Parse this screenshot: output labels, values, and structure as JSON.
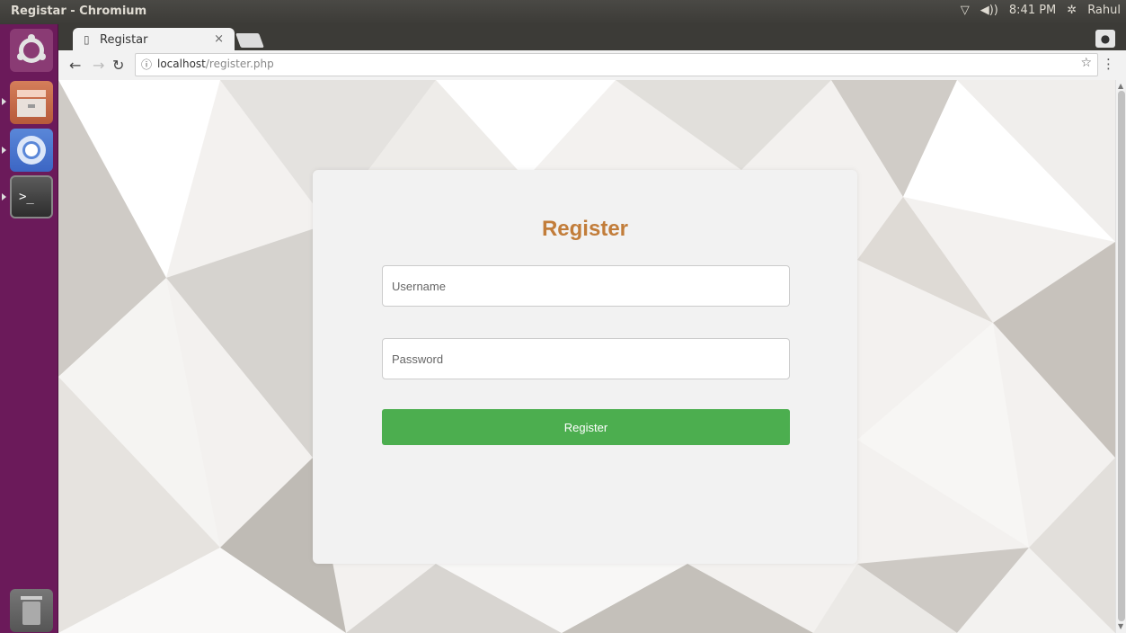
{
  "window": {
    "title": "Registar - Chromium"
  },
  "panel": {
    "time": "8:41 PM",
    "user": "Rahul"
  },
  "browser": {
    "tab_title": "Registar",
    "tab_close": "×",
    "url_host": "localhost",
    "url_path": "/register.php"
  },
  "icons": {
    "network": "wifi-icon",
    "sound": "volume-icon",
    "settings": "gear-icon",
    "page": "page-icon",
    "info": "info-icon",
    "star": "star-icon",
    "menu": "menu-icon"
  },
  "form": {
    "title": "Register",
    "username_placeholder": "Username",
    "password_placeholder": "Password",
    "submit_label": "Register"
  },
  "colors": {
    "title": "#c27d3a",
    "submit": "#4cae4f",
    "launcher": "#6b1a5a"
  }
}
